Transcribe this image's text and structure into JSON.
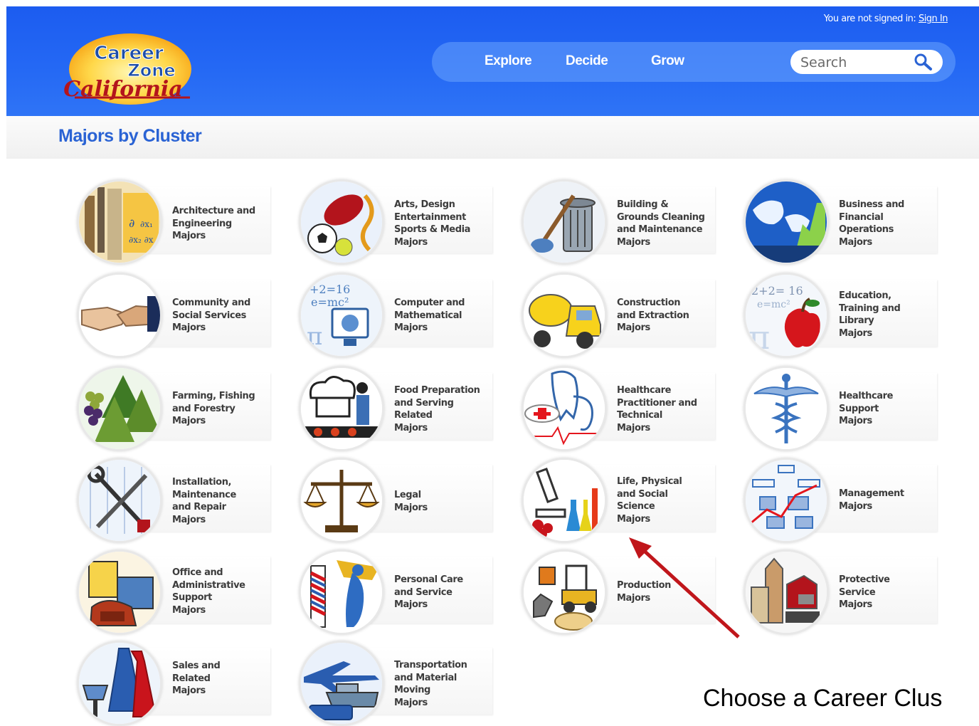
{
  "header": {
    "signin_text": "You are not signed in: ",
    "signin_link": "Sign In",
    "logo_line1": "Career",
    "logo_line2": "Zone",
    "logo_line3": "California"
  },
  "nav": {
    "explore": "Explore",
    "decide": "Decide",
    "grow": "Grow",
    "search_placeholder": "Search"
  },
  "page": {
    "title": "Majors by Cluster"
  },
  "clusters": [
    {
      "label": "Architecture and\nEngineering\nMajors",
      "icon": "architecture-icon"
    },
    {
      "label": "Arts, Design\nEntertainment\nSports & Media\nMajors",
      "icon": "arts-sports-icon"
    },
    {
      "label": "Building &\nGrounds Cleaning\nand Maintenance\nMajors",
      "icon": "trash-can-icon"
    },
    {
      "label": "Business and\nFinancial\nOperations\nMajors",
      "icon": "globe-chart-icon"
    },
    {
      "label": "Community and\nSocial Services\nMajors",
      "icon": "handshake-icon"
    },
    {
      "label": "Computer and\nMathematical\nMajors",
      "icon": "computer-math-icon"
    },
    {
      "label": "Construction\nand Extraction\nMajors",
      "icon": "cement-truck-icon"
    },
    {
      "label": "Education,\nTraining and\nLibrary\nMajors",
      "icon": "apple-icon"
    },
    {
      "label": "Farming, Fishing\nand Forestry\nMajors",
      "icon": "trees-grapes-icon"
    },
    {
      "label": "Food Preparation\nand Serving\nRelated\nMajors",
      "icon": "chef-icon"
    },
    {
      "label": "Healthcare\nPractitioner and\nTechnical\nMajors",
      "icon": "stethoscope-icon"
    },
    {
      "label": "Healthcare\nSupport\nMajors",
      "icon": "caduceus-icon"
    },
    {
      "label": "Installation,\nMaintenance\nand Repair\nMajors",
      "icon": "tools-icon"
    },
    {
      "label": "Legal\nMajors",
      "icon": "scales-icon"
    },
    {
      "label": "Life, Physical\nand Social\nScience\nMajors",
      "icon": "microscope-icon"
    },
    {
      "label": "Management\nMajors",
      "icon": "org-chart-icon"
    },
    {
      "label": "Office and\nAdministrative\nSupport\nMajors",
      "icon": "phone-folder-icon"
    },
    {
      "label": "Personal Care\nand Service\nMajors",
      "icon": "barber-pole-icon"
    },
    {
      "label": "Production\nMajors",
      "icon": "forklift-icon"
    },
    {
      "label": "Protective\nService\nMajors",
      "icon": "buildings-icon"
    },
    {
      "label": "Sales and\nRelated\nMajors",
      "icon": "dress-scale-icon"
    },
    {
      "label": "Transportation\nand Material\nMoving\nMajors",
      "icon": "vehicles-icon"
    }
  ],
  "annotation": {
    "caption": "Choose a Career Clus",
    "arrow_color": "#c0161b"
  },
  "colors": {
    "header_blue": "#2468f4",
    "title_blue": "#2a63d4"
  }
}
